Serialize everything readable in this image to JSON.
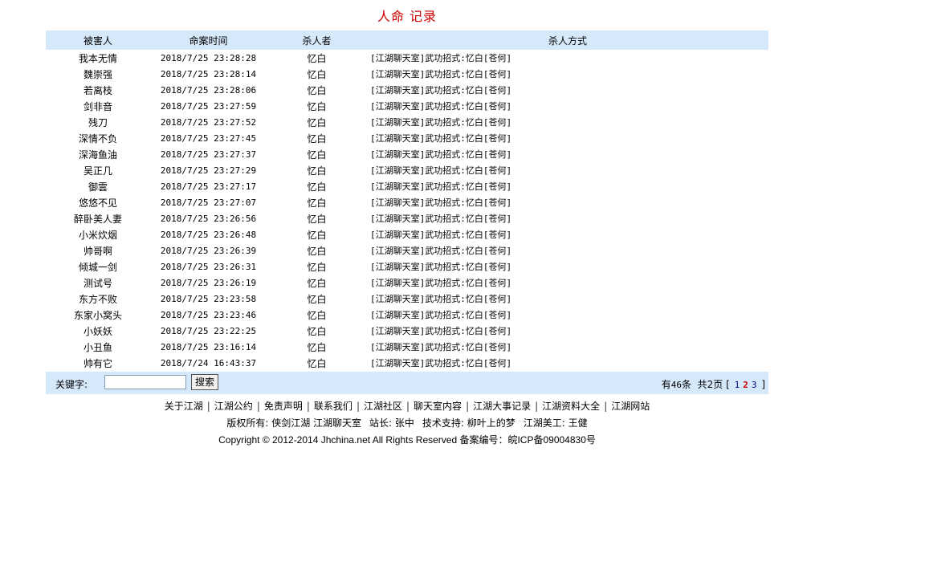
{
  "page_title": "人命 记录",
  "table": {
    "headers": [
      "被害人",
      "命案时间",
      "杀人者",
      "杀人方式"
    ],
    "rows": [
      [
        "我本无情",
        "2018/7/25 23:28:28",
        "忆白",
        "[江湖聊天室]武功招式:忆白[苍何]"
      ],
      [
        "魏崇强",
        "2018/7/25 23:28:14",
        "忆白",
        "[江湖聊天室]武功招式:忆白[苍何]"
      ],
      [
        "若离枝",
        "2018/7/25 23:28:06",
        "忆白",
        "[江湖聊天室]武功招式:忆白[苍何]"
      ],
      [
        "剑非音",
        "2018/7/25 23:27:59",
        "忆白",
        "[江湖聊天室]武功招式:忆白[苍何]"
      ],
      [
        "残刀",
        "2018/7/25 23:27:52",
        "忆白",
        "[江湖聊天室]武功招式:忆白[苍何]"
      ],
      [
        "深情不负",
        "2018/7/25 23:27:45",
        "忆白",
        "[江湖聊天室]武功招式:忆白[苍何]"
      ],
      [
        "深海鱼油",
        "2018/7/25 23:27:37",
        "忆白",
        "[江湖聊天室]武功招式:忆白[苍何]"
      ],
      [
        "吴正几",
        "2018/7/25 23:27:29",
        "忆白",
        "[江湖聊天室]武功招式:忆白[苍何]"
      ],
      [
        "御雲",
        "2018/7/25 23:27:17",
        "忆白",
        "[江湖聊天室]武功招式:忆白[苍何]"
      ],
      [
        "悠悠不见",
        "2018/7/25 23:27:07",
        "忆白",
        "[江湖聊天室]武功招式:忆白[苍何]"
      ],
      [
        "醉卧美人妻",
        "2018/7/25 23:26:56",
        "忆白",
        "[江湖聊天室]武功招式:忆白[苍何]"
      ],
      [
        "小米炊烟",
        "2018/7/25 23:26:48",
        "忆白",
        "[江湖聊天室]武功招式:忆白[苍何]"
      ],
      [
        "帅哥啊",
        "2018/7/25 23:26:39",
        "忆白",
        "[江湖聊天室]武功招式:忆白[苍何]"
      ],
      [
        "倾城一剑",
        "2018/7/25 23:26:31",
        "忆白",
        "[江湖聊天室]武功招式:忆白[苍何]"
      ],
      [
        "测试号",
        "2018/7/25 23:26:19",
        "忆白",
        "[江湖聊天室]武功招式:忆白[苍何]"
      ],
      [
        "东方不败",
        "2018/7/25 23:23:58",
        "忆白",
        "[江湖聊天室]武功招式:忆白[苍何]"
      ],
      [
        "东家小窝头",
        "2018/7/25 23:23:46",
        "忆白",
        "[江湖聊天室]武功招式:忆白[苍何]"
      ],
      [
        "小妖妖",
        "2018/7/25 23:22:25",
        "忆白",
        "[江湖聊天室]武功招式:忆白[苍何]"
      ],
      [
        "小丑鱼",
        "2018/7/25 23:16:14",
        "忆白",
        "[江湖聊天室]武功招式:忆白[苍何]"
      ],
      [
        "帅有它",
        "2018/7/24 16:43:37",
        "忆白",
        "[江湖聊天室]武功招式:忆白[苍何]"
      ]
    ]
  },
  "search": {
    "label": "关键字:",
    "value": "",
    "placeholder": "",
    "button_label": "搜索"
  },
  "pager": {
    "prefix": "有",
    "total": "46",
    "total_suffix": "条",
    "pages_label": "共2页",
    "open_bracket": "[",
    "close_bracket": "]",
    "pages": [
      "1",
      "2",
      "3"
    ],
    "current_page": "2"
  },
  "footer": {
    "links": [
      "关于江湖",
      "江湖公约",
      "免责声明",
      "联系我们",
      "江湖社区",
      "聊天室内容",
      "江湖大事记录",
      "江湖资料大全",
      "江湖网站"
    ],
    "separator": "|",
    "credits": [
      "版权所有: 侠剑江湖 江湖聊天室",
      "站长: 张中",
      "技术支持: 柳叶上的梦",
      "江湖美工: 王健"
    ],
    "copyright": "Copyright © 2012-2014 Jhchina.net All Rights Reserved 备案编号：皖ICP备09004830号"
  },
  "colors": {
    "title": "#cc0000",
    "header_bg": "#d6e9fb",
    "link": "#000080",
    "current_page": "#cc0000"
  }
}
